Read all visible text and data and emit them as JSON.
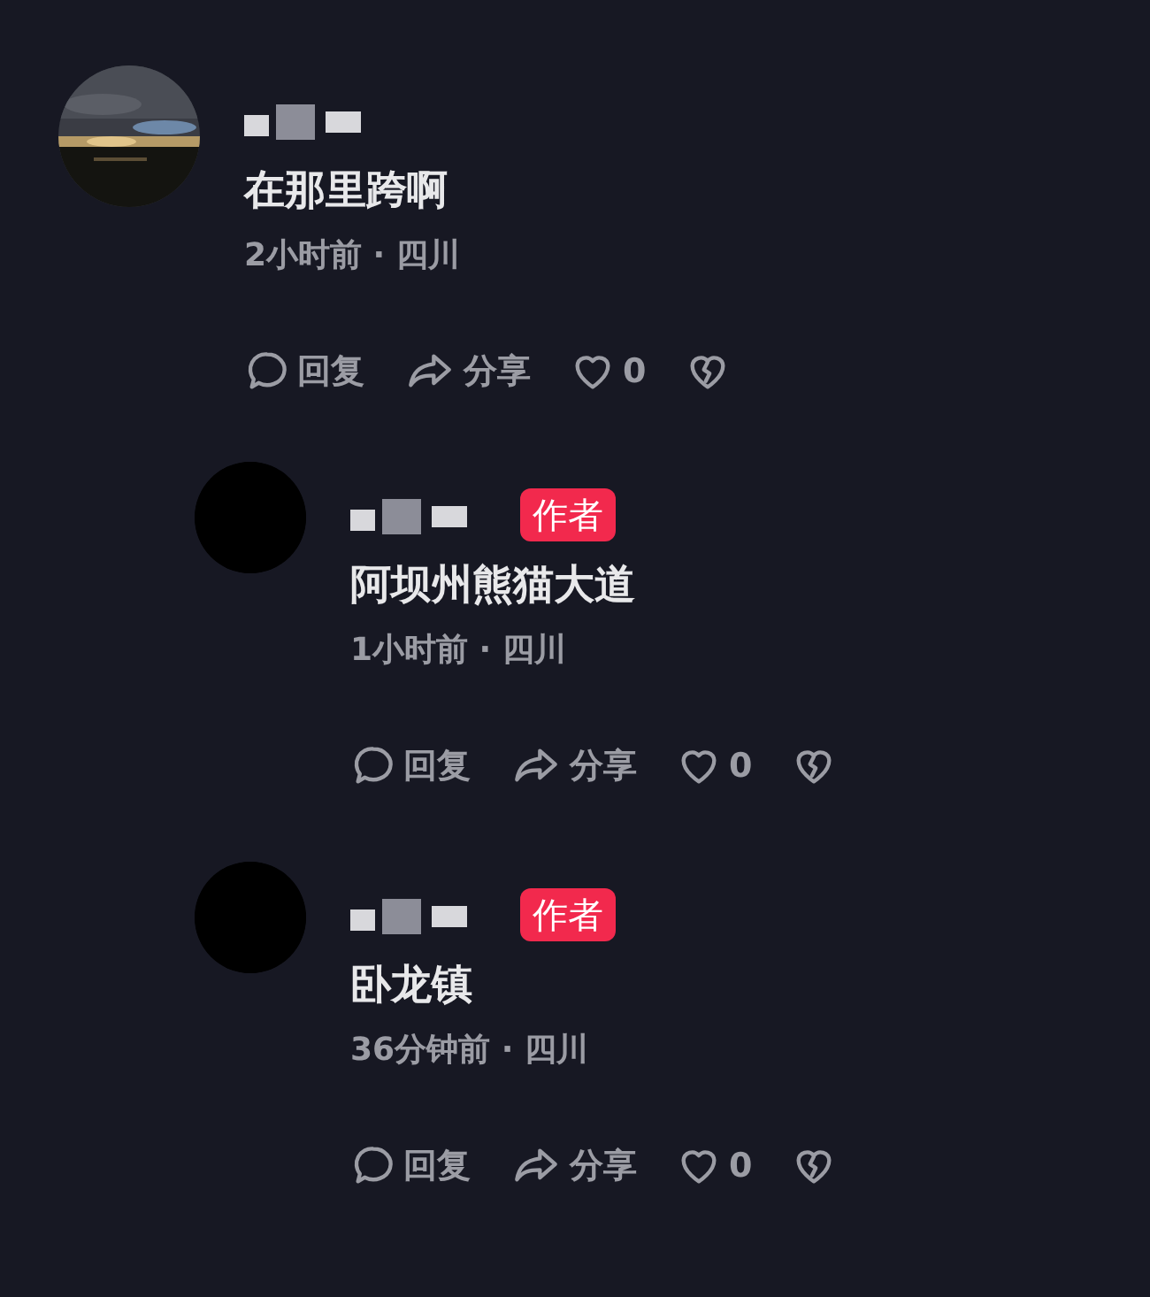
{
  "comments": [
    {
      "content": "在那里跨啊",
      "meta": "2小时前 · 四川",
      "actions": {
        "reply": "回复",
        "share": "分享",
        "likes": "0"
      },
      "replies": [
        {
          "avatar": {
            "kind": "plain"
          },
          "author_badge": "作者",
          "content": "阿坝州熊猫大道",
          "meta": "1小时前 · 四川",
          "actions": {
            "reply": "回复",
            "share": "分享",
            "likes": "0"
          }
        },
        {
          "avatar": {
            "kind": "plain"
          },
          "author_badge": "作者",
          "content": "卧龙镇",
          "meta": "36分钟前 · 四川",
          "actions": {
            "reply": "回复",
            "share": "分享",
            "likes": "0"
          }
        }
      ]
    }
  ]
}
